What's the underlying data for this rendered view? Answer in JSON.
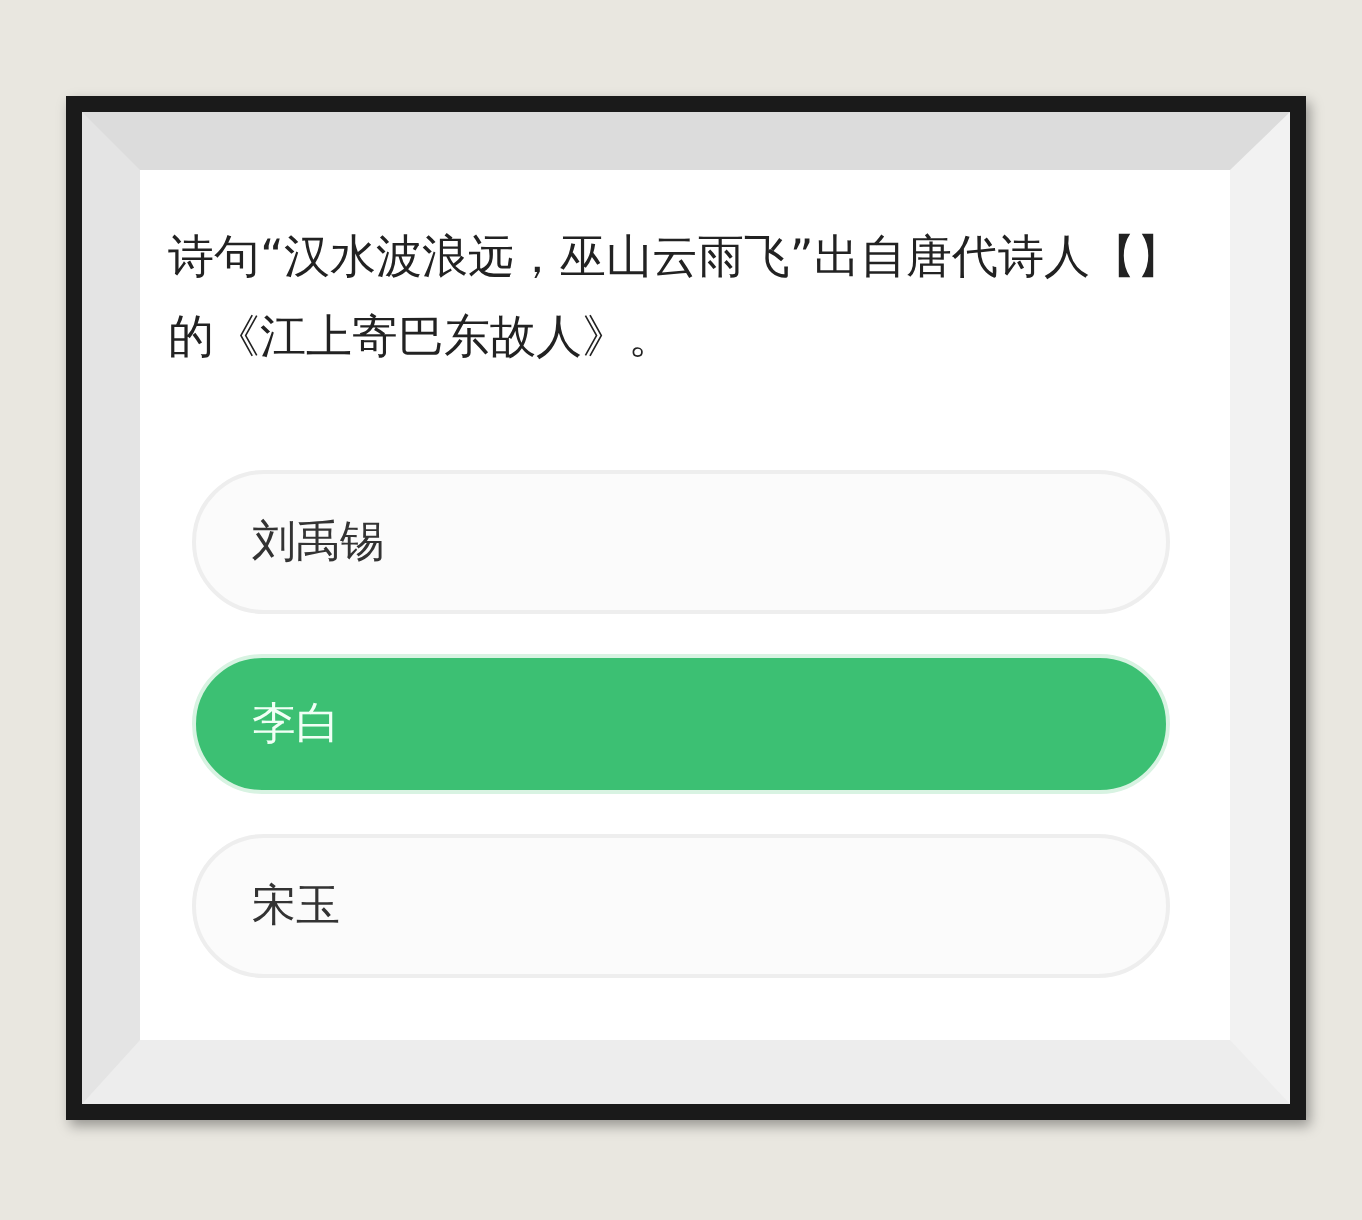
{
  "question": "诗句“汉水波浪远，巫山云雨飞”出自唐代诗人【】的《江上寄巴东故人》。",
  "options": [
    {
      "label": "刘禹锡",
      "selected": false
    },
    {
      "label": "李白",
      "selected": true
    },
    {
      "label": "宋玉",
      "selected": false
    }
  ]
}
